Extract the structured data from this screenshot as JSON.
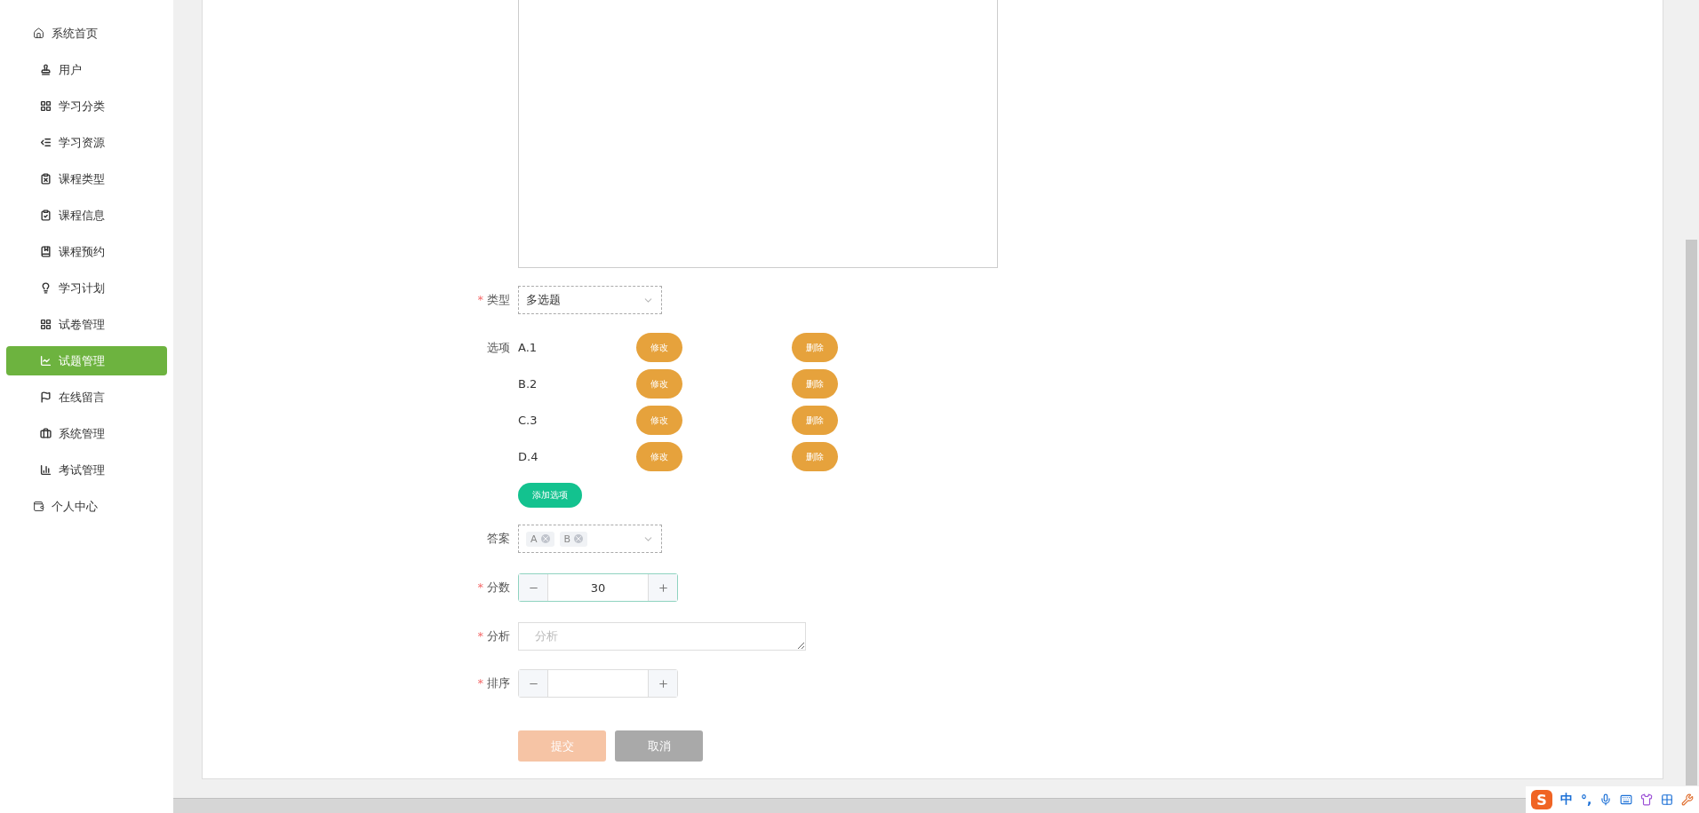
{
  "sidebar": {
    "items": [
      {
        "label": "系统首页",
        "kind": "top",
        "selected": false
      },
      {
        "label": "用户",
        "kind": "sub",
        "selected": false
      },
      {
        "label": "学习分类",
        "kind": "sub",
        "selected": false
      },
      {
        "label": "学习资源",
        "kind": "sub",
        "selected": false
      },
      {
        "label": "课程类型",
        "kind": "sub",
        "selected": false
      },
      {
        "label": "课程信息",
        "kind": "sub",
        "selected": false
      },
      {
        "label": "课程预约",
        "kind": "sub",
        "selected": false
      },
      {
        "label": "学习计划",
        "kind": "sub",
        "selected": false
      },
      {
        "label": "试卷管理",
        "kind": "sub",
        "selected": false
      },
      {
        "label": "试题管理",
        "kind": "sub",
        "selected": true
      },
      {
        "label": "在线留言",
        "kind": "sub",
        "selected": false
      },
      {
        "label": "系统管理",
        "kind": "sub",
        "selected": false
      },
      {
        "label": "考试管理",
        "kind": "sub",
        "selected": false
      },
      {
        "label": "个人中心",
        "kind": "top",
        "selected": false
      }
    ]
  },
  "form": {
    "type": {
      "label": "类型",
      "required_mark": "*",
      "value": "多选题"
    },
    "options": {
      "label": "选项",
      "items": [
        {
          "text": "A.1",
          "edit": "修改",
          "delete": "删除"
        },
        {
          "text": "B.2",
          "edit": "修改",
          "delete": "删除"
        },
        {
          "text": "C.3",
          "edit": "修改",
          "delete": "删除"
        },
        {
          "text": "D.4",
          "edit": "修改",
          "delete": "删除"
        }
      ],
      "add_button": "添加选项"
    },
    "answer": {
      "label": "答案",
      "tags": [
        "A",
        "B"
      ]
    },
    "score": {
      "label": "分数",
      "required_mark": "*",
      "value": "30"
    },
    "analysis": {
      "label": "分析",
      "required_mark": "*",
      "placeholder": "分析"
    },
    "sort": {
      "label": "排序",
      "required_mark": "*"
    },
    "buttons": [
      {
        "label": "提交",
        "kind": "submit",
        "disabled": true
      },
      {
        "label": "取消",
        "kind": "cancel",
        "disabled": false
      }
    ]
  },
  "ime": {
    "logo": "S",
    "items": [
      "中",
      "°,"
    ]
  }
}
